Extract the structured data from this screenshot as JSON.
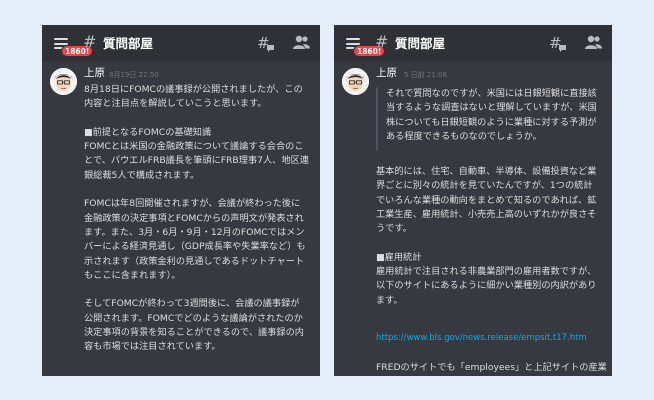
{
  "left": {
    "badge": "1860!",
    "channel": "質問部屋",
    "author": "上原",
    "time": "8月19日 22:50",
    "body": "8月18日にFOMCの議事録が公開されましたが、この\n内容と注目点を解説していこうと思います。\n\n■前提となるFOMCの基礎知識\nFOMCとは米国の金融政策について議論する会合のこ\nとで、パウエルFRB議長を筆頭にFRB理事7人、地区連\n銀総裁5人で構成されます。\n\nFOMCは年8回開催されますが、会議が終わった後に\n金融政策の決定事項とFOMCからの声明文が発表され\nます。また、3月・6月・9月・12月のFOMCではメン\nバーによる経済見通し（GDP成長率や失業率など）も\n示されます（政策金利の見通しであるドットチャート\nもここに含まれます）。\n\nそしてFOMCが終わって3週間後に、会議の議事録が\n公開されます。FOMCでどのような議論がされたのか\n決定事項の背景を知ることができるので、議事録の内\n容も市場では注目されています。"
  },
  "right": {
    "badge": "1860!",
    "channel": "質問部屋",
    "author": "上原",
    "time": "5 日前 21:08",
    "quote": "それで質問なのですが、米国には日銀短観に直接該\n当するような調査はないと理解していますが、米国\n株についても日銀短観のように業種に対する予測が\nある程度できるものなのでしょうか。",
    "body": "基本的には、住宅、自動車、半導体、設備投資など業\n界ごとに別々の統計を見ていたんですが、1つの統計\nでいろんな業種の動向をまとめて知るのであれば、鉱\n工業生産、雇用統計、小売売上高のいずれかが良さそ\nうです。\n\n■雇用統計\n雇用統計で注目される非農業部門の雇用者数ですが、\n以下のサイトにあるように細かい業種別の内訳があり\nます。",
    "link": "https://www.bls.gov/news.release/empsit.t17.htm",
    "tail": "FREDのサイトでも「employees」と上記サイトの産業"
  },
  "icons": [
    "hamburger-menu-icon",
    "hash-icon",
    "threads-icon",
    "members-icon"
  ],
  "colors": {
    "background": "#e3eefa",
    "panel": "#36393f",
    "header": "#2f3136",
    "badge": "#ed4245",
    "link": "#00aff4",
    "text": "#dcddde",
    "muted": "#72767d"
  }
}
